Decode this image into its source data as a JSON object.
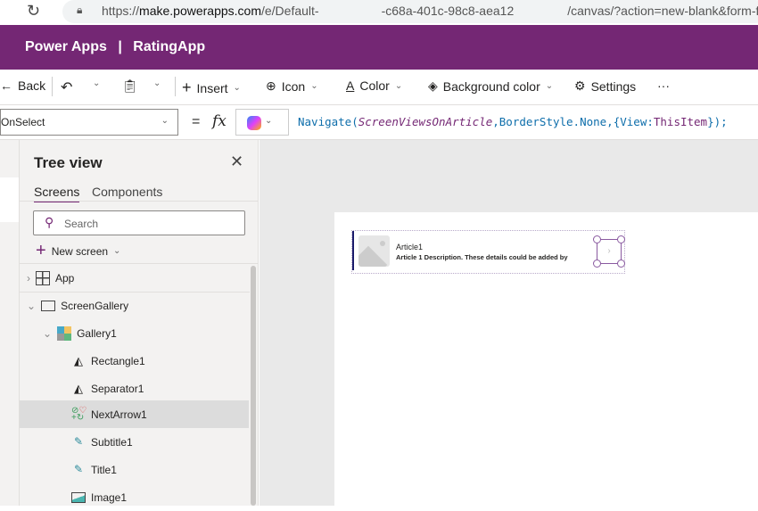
{
  "browser": {
    "url_prefix": "https://",
    "url_domain": "make.powerapps.com",
    "url_path1": "/e/Default-",
    "url_path2": "-c68a-401c-98c8-aea12",
    "url_path3": "/canvas/?action=new-blank&form-factor="
  },
  "header": {
    "app": "Power Apps",
    "separator": "|",
    "title": "RatingApp"
  },
  "toolbar": {
    "back": "Back",
    "insert": "Insert",
    "icon": "Icon",
    "color": "Color",
    "background_color": "Background color",
    "settings": "Settings",
    "more": "···"
  },
  "formula": {
    "property": "OnSelect",
    "equals": "=",
    "fx": "fx",
    "fn": "Navigate(",
    "arg1": "ScreenViewsOnArticle",
    "rest1": ",BorderStyle.None,{View:",
    "arg2": "ThisItem",
    "rest2": "});"
  },
  "tree": {
    "title": "Tree view",
    "tabs": [
      "Screens",
      "Components"
    ],
    "search_placeholder": "Search",
    "new_screen": "New screen",
    "items": [
      {
        "label": "App"
      },
      {
        "label": "ScreenGallery"
      },
      {
        "label": "Gallery1"
      },
      {
        "label": "Rectangle1"
      },
      {
        "label": "Separator1"
      },
      {
        "label": "NextArrow1"
      },
      {
        "label": "Subtitle1"
      },
      {
        "label": "Title1"
      },
      {
        "label": "Image1"
      }
    ]
  },
  "gallery": {
    "title": "Article1",
    "description": "Article 1 Description. These details could be added by"
  },
  "colors": {
    "brand": "#742774",
    "accent": "#742774"
  }
}
